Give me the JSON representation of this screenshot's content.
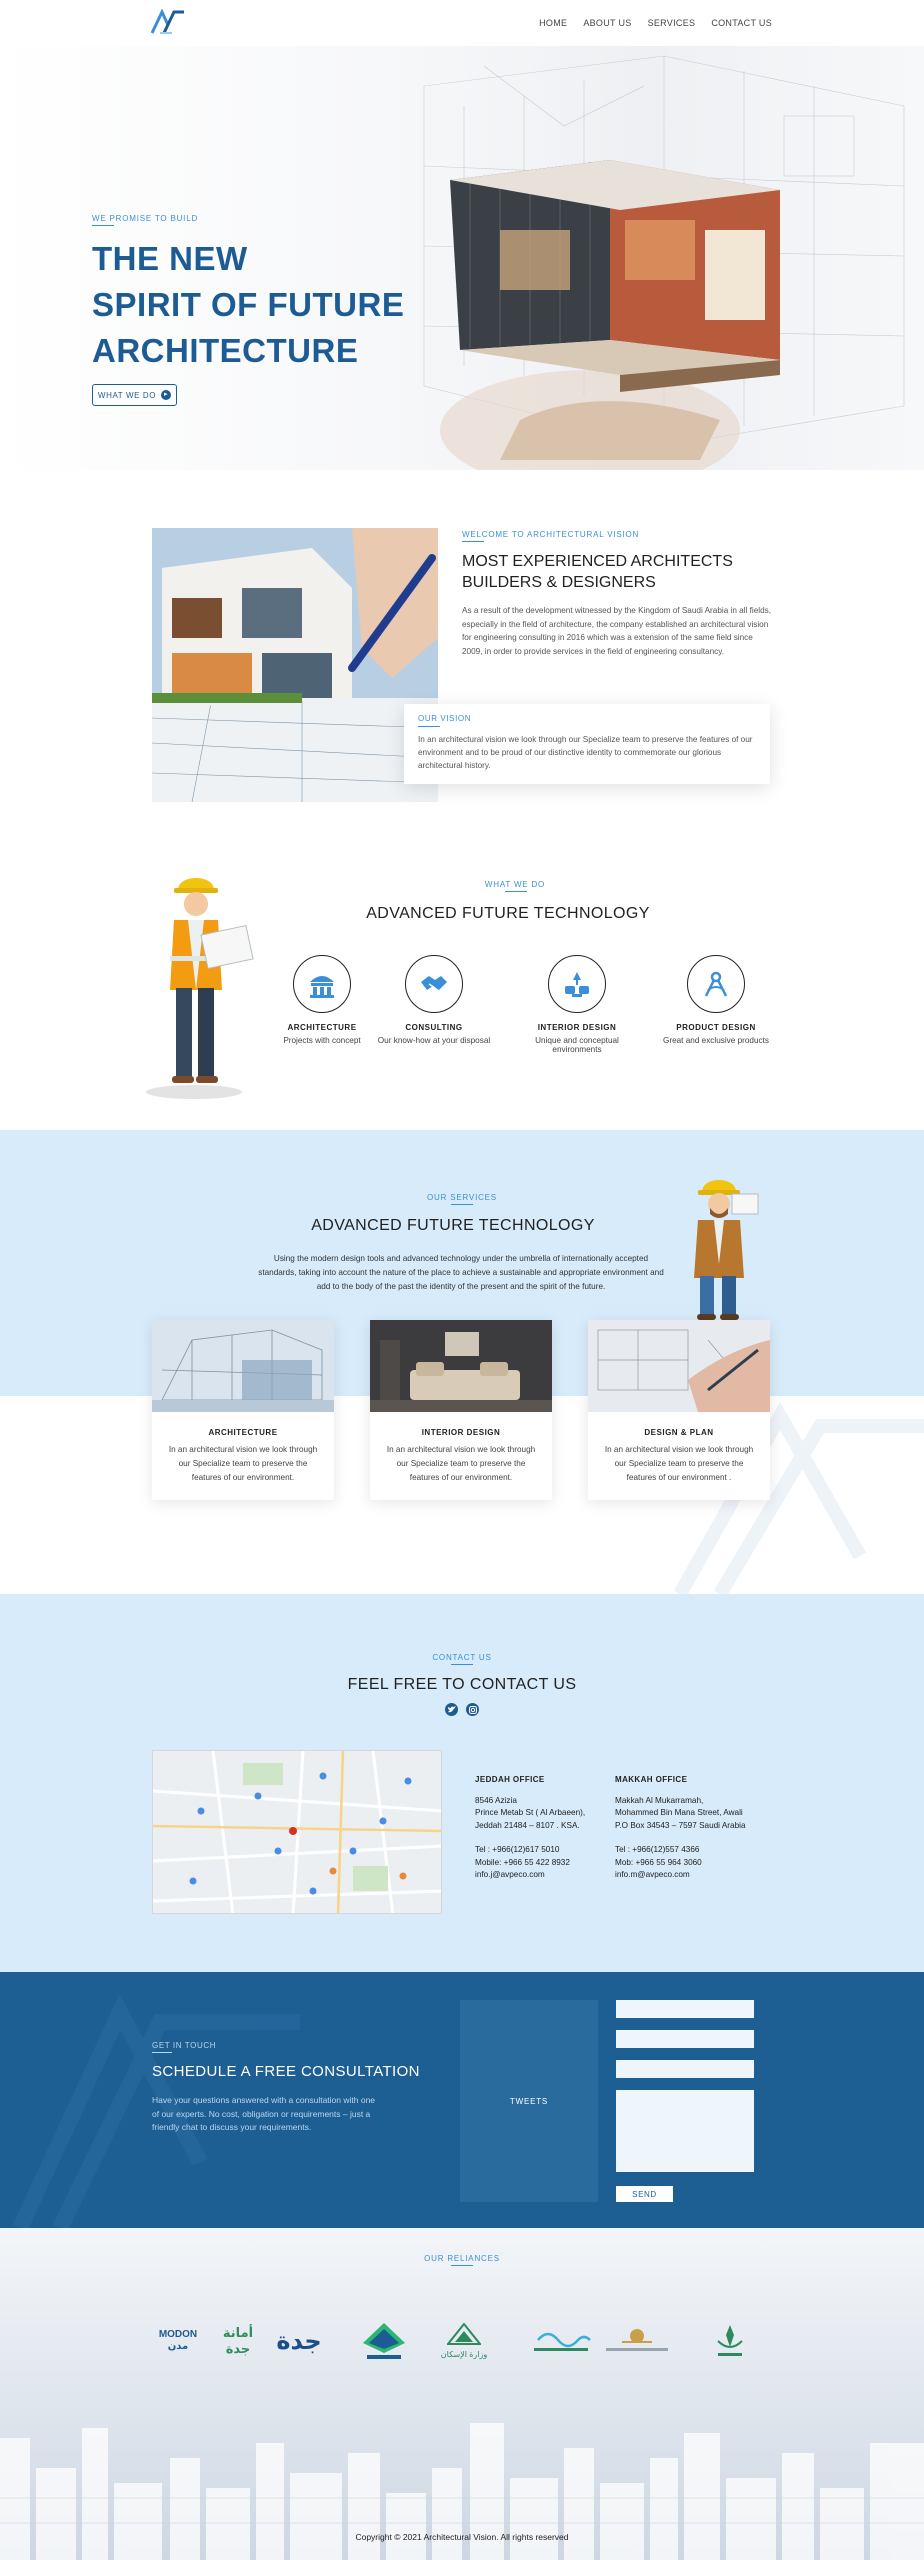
{
  "nav": {
    "items": [
      "HOME",
      "ABOUT US",
      "SERVICES",
      "CONTACT US"
    ]
  },
  "hero": {
    "tag": "WE PROMISE TO BUILD",
    "title_lines": [
      "THE NEW",
      "SPIRIT OF FUTURE",
      "ARCHITECTURE"
    ],
    "button_label": "WHAT WE DO"
  },
  "about": {
    "tag": "WELCOME TO ARCHITECTURAL VISION",
    "title_line1": "MOST EXPERIENCED ARCHITECTS",
    "title_line2": "BUILDERS & DESIGNERS",
    "text": "As a result of the development witnessed by the Kingdom of Saudi Arabia in all fields, especially in the field of architecture, the company established an architectural vision for engineering consulting in 2016 which was a extension of the same field since 2009, in order to provide services in the field of engineering consultancy.",
    "vision_tag": "OUR VISION",
    "vision_text": "In an architectural vision we look through our Specialize team to preserve the features of our environment and to be proud of our distinctive identity to commemorate our glorious architectural history."
  },
  "what_we_do": {
    "tag": "WHAT WE DO",
    "title": "ADVANCED FUTURE TECHNOLOGY",
    "features": [
      {
        "name": "ARCHITECTURE",
        "desc": "Projects with concept",
        "icon": "building-icon"
      },
      {
        "name": "CONSULTING",
        "desc": "Our know-how at your disposal",
        "icon": "handshake-icon"
      },
      {
        "name": "INTERIOR DESIGN",
        "desc": "Unique and conceptual environments",
        "icon": "furniture-icon"
      },
      {
        "name": "PRODUCT DESIGN",
        "desc": "Great and exclusive products",
        "icon": "design-tools-icon"
      }
    ]
  },
  "services": {
    "tag": "OUR SERVICES",
    "title": "ADVANCED FUTURE TECHNOLOGY",
    "text": "Using the modern design tools and advanced technology under the umbrella of internationally accepted standards, taking into account the nature of the place to achieve a sustainable and appropriate environment and add to the body of the past the identity of the present and the spirit of the future.",
    "cards": [
      {
        "name": "ARCHITECTURE",
        "desc": "In an architectural vision we look through our Specialize team to preserve the features of our environment."
      },
      {
        "name": "INTERIOR DESIGN",
        "desc": "In an architectural vision we look through our Specialize team to preserve the features of our environment."
      },
      {
        "name": "DESIGN & PLAN",
        "desc": "In an architectural vision we look through our Specialize team to preserve the features of our environment ."
      }
    ]
  },
  "contact": {
    "tag": "CONTACT US",
    "title": "FEEL FREE TO CONTACT US",
    "offices": [
      {
        "name": "JEDDAH OFFICE",
        "address": [
          "8546 Azizia",
          "Prince Metab St ( Al Arbaeen),",
          "Jeddah 21484 – 8107 . KSA."
        ],
        "tel": "Tel : +966(12)617 5010",
        "mobile": "Mobile: +966 55 422 8932",
        "email": "info.j@avpeco.com"
      },
      {
        "name": "MAKKAH OFFICE",
        "address": [
          "Makkah Al Mukarramah,",
          "Mohammed Bin Mana Street, Awali",
          "P.O Box 34543 – 7597 Saudi Arabia"
        ],
        "tel": "Tel : +966(12)557 4366",
        "mobile": "Mob: +966 55 964 3060",
        "email": "info.m@avpeco.com"
      }
    ]
  },
  "consultation": {
    "tag": "GET IN TOUCH",
    "title": "SCHEDULE A  FREE CONSULTATION",
    "text": "Have your questions answered with a consultation with one of our experts. No cost, obligation or requirements – just a friendly chat to discuss your requirements.",
    "tweets_label": "TWEETS",
    "send_label": "SEND"
  },
  "reliances": {
    "tag": "OUR RELIANCES",
    "logos": [
      "modon-logo",
      "amanat-jeddah-logo",
      "jeddah-logo",
      "general-authority-logo",
      "housing-ministry-logo",
      "environment-ministry-logo",
      "emblem-logo",
      "municipal-ministry-logo"
    ],
    "logo_texts": {
      "modon": "MODON مدن",
      "amanat": "أمانة جدة",
      "jeddah": "جدة",
      "housing": "وزارة الإسكان"
    }
  },
  "footer": {
    "copyright": "Copyright © 2021 Architectural Vision. All rights reserved"
  },
  "colors": {
    "primary": "#1c5b93",
    "accent": "#3a8fd8",
    "light_blue_bg": "#d8ebfa",
    "consult_bg": "#1d5f93"
  }
}
